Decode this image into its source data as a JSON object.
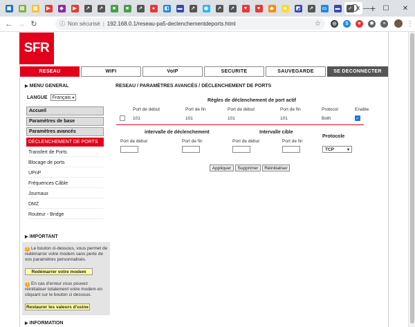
{
  "browser": {
    "tabs": [
      {
        "name": "tab-1",
        "color": "#1e73be",
        "glyph": "▣"
      },
      {
        "name": "tab-2",
        "color": "#7cb342",
        "glyph": "▤"
      },
      {
        "name": "tab-3",
        "color": "#fbc02d",
        "glyph": "▥"
      },
      {
        "name": "tab-4",
        "color": "#e53935",
        "glyph": "▶"
      },
      {
        "name": "tab-5",
        "color": "#8e24aa",
        "glyph": "◆"
      },
      {
        "name": "tab-6",
        "color": "#e53935",
        "glyph": "▶"
      },
      {
        "name": "tab-7",
        "color": "#555555",
        "glyph": "↗"
      },
      {
        "name": "tab-8",
        "color": "#555555",
        "glyph": "↗"
      },
      {
        "name": "tab-9",
        "color": "#43a047",
        "glyph": "■"
      },
      {
        "name": "tab-10",
        "color": "#43a047",
        "glyph": "■"
      },
      {
        "name": "tab-11",
        "color": "#555555",
        "glyph": "↗"
      },
      {
        "name": "tab-12",
        "color": "#e53935",
        "glyph": "●"
      },
      {
        "name": "tab-13",
        "color": "#1e88e5",
        "glyph": "◧"
      },
      {
        "name": "tab-14",
        "color": "#3949ab",
        "glyph": "▬"
      },
      {
        "name": "tab-15",
        "color": "#555555",
        "glyph": "↗"
      },
      {
        "name": "tab-16",
        "color": "#29b6f6",
        "glyph": "◉"
      },
      {
        "name": "tab-17",
        "color": "#555555",
        "glyph": "↗"
      },
      {
        "name": "tab-18",
        "color": "#555555",
        "glyph": "↗"
      },
      {
        "name": "tab-19",
        "color": "#e53935",
        "glyph": "▼"
      },
      {
        "name": "tab-20",
        "color": "#e53935",
        "glyph": "♥"
      },
      {
        "name": "tab-21",
        "color": "#fb8c00",
        "glyph": "◆"
      },
      {
        "name": "tab-22",
        "color": "#fdd835",
        "glyph": "☻"
      },
      {
        "name": "tab-23",
        "color": "#3949ab",
        "glyph": "◩"
      },
      {
        "name": "tab-24",
        "color": "#555555",
        "glyph": "↗"
      },
      {
        "name": "tab-25",
        "color": "#1e88e5",
        "glyph": "▭"
      },
      {
        "name": "tab-26",
        "color": "#3949ab",
        "glyph": "▬"
      }
    ],
    "active_tab_close": "✕",
    "new_tab": "+",
    "window_controls": [
      "—",
      "☐",
      "✕"
    ],
    "back": "←",
    "forward": "→",
    "reload": "↻",
    "info_glyph": "ⓘ",
    "security": "Non sécurisé",
    "url": "192.168.0.1/reseau-pa5-declenchementdeports.html",
    "star": "☆",
    "kebab": "⋮",
    "extensions": [
      {
        "name": "ext-1",
        "color": "#3c4043",
        "glyph": "◎"
      },
      {
        "name": "ext-2",
        "color": "#1e88e5",
        "glyph": "S"
      },
      {
        "name": "ext-3",
        "color": "#e53935",
        "glyph": "♥"
      },
      {
        "name": "ext-4",
        "color": "#5f6368",
        "glyph": "✱"
      },
      {
        "name": "ext-5",
        "color": "#5f6368",
        "glyph": "≡"
      }
    ]
  },
  "logo": "SFR",
  "nav": {
    "items": [
      "RESEAU",
      "WIFI",
      "VoIP",
      "SECURITE",
      "SAUVEGARDE",
      "SE DECONNECTER"
    ]
  },
  "sidebar": {
    "title": "MENU GENERAL",
    "lang_label": "LANGUE",
    "lang_value": "Français",
    "sections": [
      "Accueil",
      "Paramètres de base",
      "Paramètres avancés"
    ],
    "items": [
      "DÉCLENCHEMENT DE PORTS",
      "Transfert de Ports",
      "Blocage de ports",
      "UPnP",
      "Fréquences Câble",
      "Journaux",
      "DMZ",
      "Routeur - Bridge"
    ]
  },
  "important": {
    "title": "IMPORTANT",
    "text1": "Le bouton ci-dessous, vous permet de redémarrer votre modem sans perte de vos paramètres personnalisés.",
    "button1": "Redémarrer votre modem",
    "text2": "En cas d'erreur vous pouvez réinitialiser totalement votre modem en cliquant sur le bouton ci dessous.",
    "button2": "Restaurer les valeurs d'usine"
  },
  "information_title": "INFORMATION",
  "main": {
    "breadcrumb": "RESEAU / PARAMÈTRES AVANCÉS / DÉCLENCHEMENT DE PORTS",
    "rules_title": "Règles de déclenchement de port actif",
    "columns": [
      "Port de début",
      "Port de fin",
      "Port de début",
      "Port de fin",
      "Protocol",
      "Enable"
    ],
    "row": [
      "101",
      "101",
      "101",
      "101",
      "Both"
    ],
    "row_enabled": true,
    "trigger_title": "intervalle de déclenchement",
    "target_title": "Intervalle cible",
    "field_labels": [
      "Port de début",
      "Port de fin",
      "Port de début",
      "Port de fin"
    ],
    "protocol_label": "Protocole",
    "protocol_value": "TCP",
    "buttons": [
      "Appliquer",
      "Supprimer",
      "Réinitialiser"
    ]
  },
  "colors": {
    "brand": "#e2001a",
    "nav_dark": "#555555",
    "button_yellow": "#ffffa0"
  }
}
